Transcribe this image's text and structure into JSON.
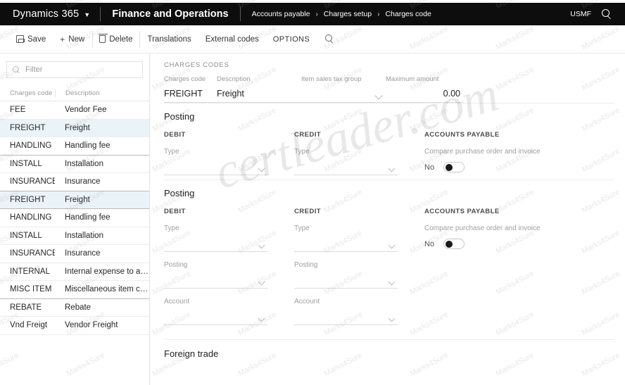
{
  "topbar": {
    "brand": "Dynamics 365",
    "brand_chevron_icon": "chevron-down-icon",
    "app_title": "Finance and Operations",
    "breadcrumb": [
      "Accounts payable",
      "Charges setup",
      "Charges code"
    ],
    "breadcrumb_separator": "›",
    "company": "USMF",
    "search_icon": "search-icon",
    "background_color": "#0d0d0d",
    "text_color": "#ffffff"
  },
  "toolbar": {
    "save_label": "Save",
    "save_icon": "save-icon",
    "new_label": "New",
    "new_icon": "plus-icon",
    "delete_label": "Delete",
    "delete_icon": "trash-icon",
    "translations_label": "Translations",
    "external_codes_label": "External codes",
    "options_label": "OPTIONS",
    "search_icon": "search-icon"
  },
  "sidebar": {
    "filter": {
      "placeholder": "Filter",
      "value": "",
      "icon": "search-icon"
    },
    "columns": [
      "Charges code",
      "Description"
    ],
    "rows": [
      {
        "code": "FEE",
        "description": "Vendor Fee",
        "selected": false
      },
      {
        "code": "FREIGHT",
        "description": "Freight",
        "selected": true
      },
      {
        "code": "HANDLING",
        "description": "Handling fee",
        "selected": false
      },
      {
        "code": "INSTALL",
        "description": "Installation",
        "selected": false
      },
      {
        "code": "INSURANCE",
        "description": "Insurance",
        "selected": false
      },
      {
        "code": "FREIGHT",
        "description": "Freight",
        "selected": true
      },
      {
        "code": "HANDLING",
        "description": "Handling fee",
        "selected": false
      },
      {
        "code": "INSTALL",
        "description": "Installation",
        "selected": false
      },
      {
        "code": "INSURANCE",
        "description": "Insurance",
        "selected": false
      },
      {
        "code": "INTERNAL",
        "description": "Internal expense to a l...",
        "selected": false
      },
      {
        "code": "MISC ITEM",
        "description": "Miscellaneous item ch...",
        "selected": false
      },
      {
        "code": "REBATE",
        "description": "Rebate",
        "selected": false
      },
      {
        "code": "Vnd Freigt",
        "description": "Vendor Freight",
        "selected": false
      }
    ],
    "selected_row_color": "#eaf3f8"
  },
  "main": {
    "section_caption": "CHARGES CODES",
    "header_fields": {
      "charges_code": {
        "label": "Charges code",
        "value": "FREIGHT"
      },
      "description": {
        "label": "Description",
        "value": "Freight"
      },
      "item_sales_tax_group": {
        "label": "Item sales tax group",
        "value": "",
        "icon": "chevron-down-icon"
      },
      "maximum_amount": {
        "label": "Maximum amount",
        "value": "0.00"
      }
    },
    "posting_section_1": {
      "title": "Posting",
      "debit": {
        "group_label": "DEBIT",
        "type": {
          "label": "Type",
          "value": "",
          "icon": "chevron-down-icon"
        }
      },
      "credit": {
        "group_label": "CREDIT",
        "type": {
          "label": "Type",
          "value": "",
          "icon": "chevron-down-icon"
        }
      },
      "accounts_payable": {
        "group_label": "ACCOUNTS PAYABLE",
        "compare_label": "Compare purchase order and invoice",
        "toggle_value": "No"
      }
    },
    "posting_section_2": {
      "title": "Posting",
      "debit": {
        "group_label": "DEBIT",
        "type": {
          "label": "Type",
          "value": "",
          "icon": "chevron-down-icon"
        },
        "posting": {
          "label": "Posting",
          "value": "",
          "icon": "chevron-down-icon"
        },
        "account": {
          "label": "Account",
          "value": "",
          "icon": "chevron-down-icon"
        }
      },
      "credit": {
        "group_label": "CREDIT",
        "type": {
          "label": "Type",
          "value": "",
          "icon": "chevron-down-icon"
        },
        "posting": {
          "label": "Posting",
          "value": "",
          "icon": "chevron-down-icon"
        },
        "account": {
          "label": "Account",
          "value": "",
          "icon": "chevron-down-icon"
        }
      },
      "accounts_payable": {
        "group_label": "ACCOUNTS PAYABLE",
        "compare_label": "Compare purchase order and invoice",
        "toggle_value": "No"
      }
    },
    "foreign_trade": {
      "title": "Foreign trade"
    }
  },
  "watermarks": {
    "primary": "certleader.com",
    "tile": "Marks4Sure"
  }
}
